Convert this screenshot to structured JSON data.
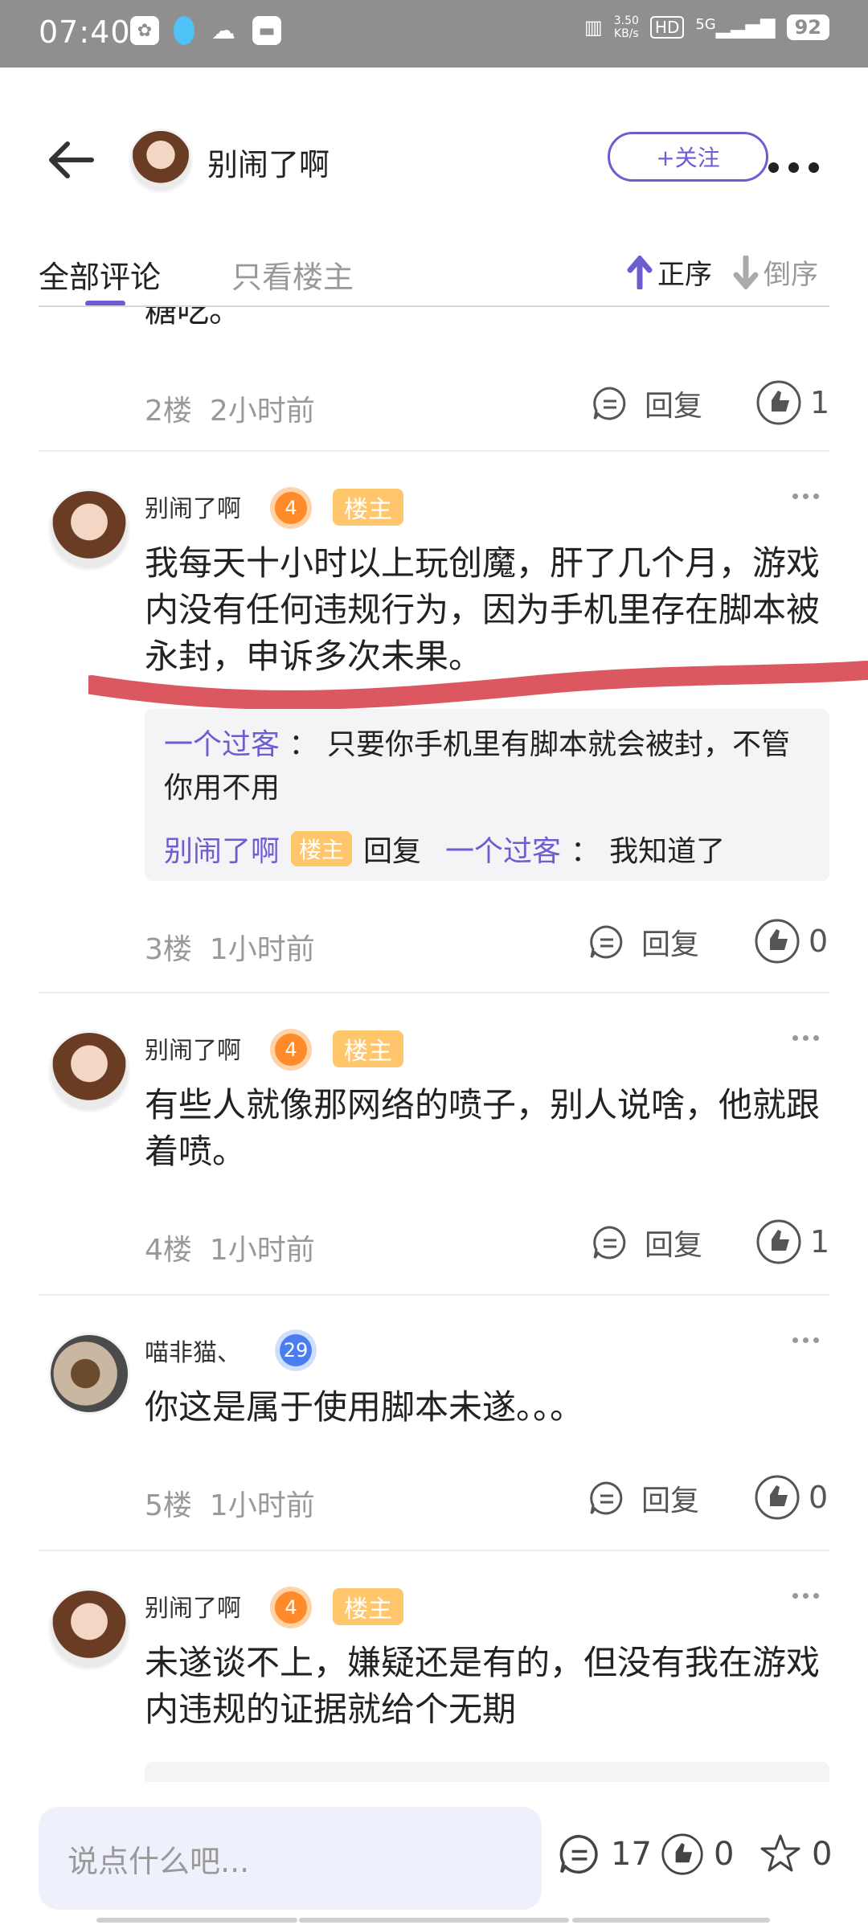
{
  "status_bar": {
    "time": "07:40",
    "speed_value": "3.50",
    "speed_unit": "KB/s",
    "hd": "HD",
    "network": "5G",
    "battery": "92"
  },
  "header": {
    "username": "别闹了啊",
    "follow_label": "+关注"
  },
  "tabs": {
    "all": "全部评论",
    "op_only": "只看楼主",
    "sort_asc": "正序",
    "sort_desc": "倒序"
  },
  "partial_comment": {
    "text": "糖吃。",
    "floor": "2楼",
    "time": "2小时前",
    "reply_label": "回复",
    "likes": "1"
  },
  "comments": [
    {
      "name": "别闹了啊",
      "level": "4",
      "badge": "楼主",
      "text": "我每天十小时以上玩创魔，肝了几个月，游戏内没有任何违规行为，因为手机里存在脚本被永封，申诉多次未果。",
      "sub": {
        "user1": "一个过客",
        "sep1": "：",
        "text1": "只要你手机里有脚本就会被封，不管你用不用",
        "user2": "别闹了啊",
        "badge2": "楼主",
        "reply_word": "回复",
        "user3": "一个过客",
        "sep2": "：",
        "text2": "我知道了"
      },
      "floor": "3楼",
      "time": "1小时前",
      "reply_label": "回复",
      "likes": "0"
    },
    {
      "name": "别闹了啊",
      "level": "4",
      "badge": "楼主",
      "text": "有些人就像那网络的喷子，别人说啥，他就跟着喷。",
      "floor": "4楼",
      "time": "1小时前",
      "reply_label": "回复",
      "likes": "1"
    },
    {
      "name": "喵非猫、",
      "level": "29",
      "text": "你这是属于使用脚本未遂。。。",
      "floor": "5楼",
      "time": "1小时前",
      "reply_label": "回复",
      "likes": "0"
    },
    {
      "name": "别闹了啊",
      "level": "4",
      "badge": "楼主",
      "text": "未遂谈不上，嫌疑还是有的，但没有我在游戏内违规的证据就给个无期"
    }
  ],
  "bottom_bar": {
    "placeholder": "说点什么吧...",
    "comment_count": "17",
    "like_count": "0",
    "star_count": "0"
  },
  "colors": {
    "accent": "#6c5ed1",
    "badge": "#ffc66b",
    "level": "#ff8a2a",
    "annotation": "#d8464f"
  }
}
